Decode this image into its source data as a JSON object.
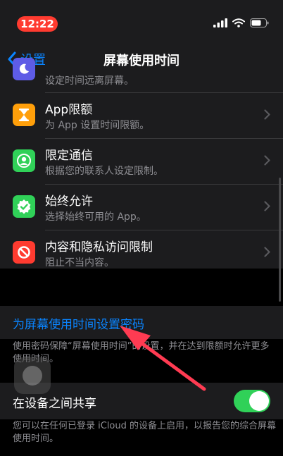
{
  "status_bar": {
    "time": "12:22"
  },
  "nav": {
    "back_label": "设置",
    "title": "屏幕使用时间"
  },
  "rows": [
    {
      "title": "",
      "subtitle": "设定时间远离屏幕。",
      "icon": "moon-icon",
      "color": "#5e5ce6"
    },
    {
      "title": "App限额",
      "subtitle": "为 App 设置时间限额。",
      "icon": "hourglass-icon",
      "color": "#ff9f0a"
    },
    {
      "title": "限定通信",
      "subtitle": "根据您的联系人设定限制。",
      "icon": "contact-icon",
      "color": "#30d158"
    },
    {
      "title": "始终允许",
      "subtitle": "选择始终可用的 App。",
      "icon": "checkmark-badge-icon",
      "color": "#30d158"
    },
    {
      "title": "内容和隐私访问限制",
      "subtitle": "阻止不当内容。",
      "icon": "restriction-icon",
      "color": "#ff3b30"
    }
  ],
  "passcode_link": "为屏幕使用时间设置密码",
  "passcode_footer": "使用密码保障“屏幕使用时间”的设置，并在达到限额时允许更多使用时间。",
  "share": {
    "label": "在设备之间共享",
    "enabled": true
  },
  "share_footer": "您可以在任何已登录 iCloud 的设备上启用，以报告您的综合屏幕使用时间。",
  "colors": {
    "accent": "#0a84ff",
    "toggle_on": "#30d158",
    "time_pill": "#ff3b30",
    "arrow": "#ff3b52"
  }
}
